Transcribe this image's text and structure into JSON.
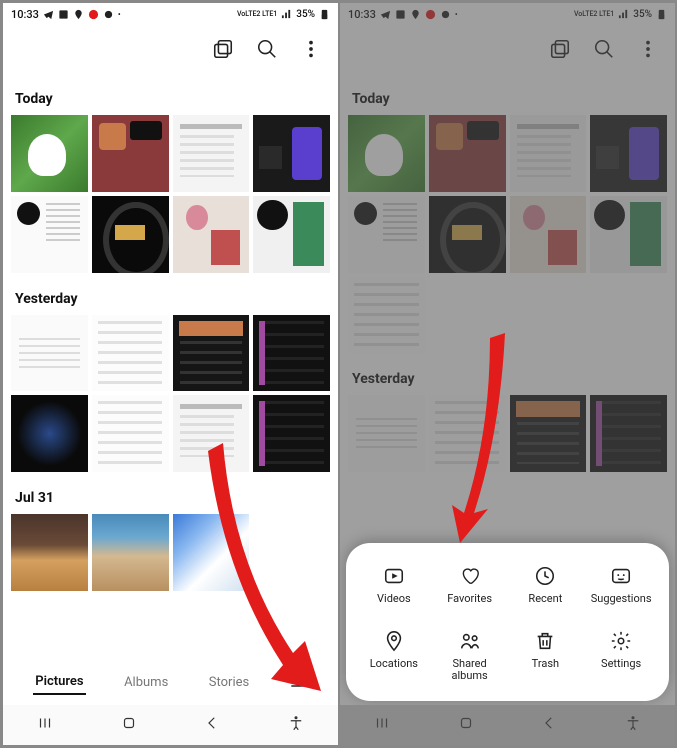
{
  "statusbar": {
    "time": "10:33",
    "battery": "35%",
    "signal_label": "VoLTE2 LTE1"
  },
  "sections": {
    "today": "Today",
    "yesterday": "Yesterday",
    "jul31": "Jul 31"
  },
  "tabs": {
    "pictures": "Pictures",
    "albums": "Albums",
    "stories": "Stories"
  },
  "sheet": {
    "videos": "Videos",
    "favorites": "Favorites",
    "recent": "Recent",
    "suggestions": "Suggestions",
    "locations": "Locations",
    "shared_albums": "Shared\nalbums",
    "trash": "Trash",
    "settings": "Settings"
  }
}
